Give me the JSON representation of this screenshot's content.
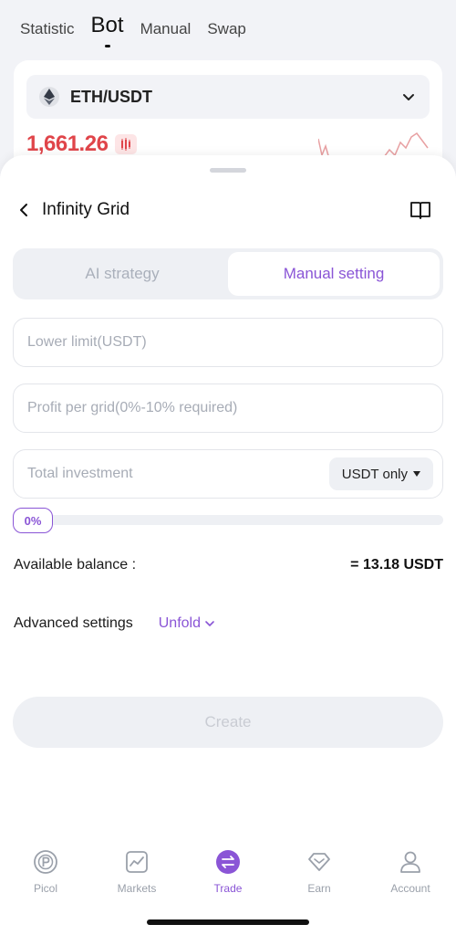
{
  "top_tabs": [
    {
      "label": "Statistic"
    },
    {
      "label": "Bot"
    },
    {
      "label": "Manual"
    },
    {
      "label": "Swap"
    }
  ],
  "pair": {
    "name": "ETH/USDT",
    "price": "1,661.26",
    "price_color": "#e0454a",
    "icon": "ethereum-icon"
  },
  "sheet": {
    "title": "Infinity Grid",
    "segments": [
      {
        "label": "AI strategy",
        "active": false
      },
      {
        "label": "Manual setting",
        "active": true
      }
    ],
    "fields": {
      "lower_limit_placeholder": "Lower limit(USDT)",
      "profit_placeholder": "Profit per grid(0%-10% required)",
      "investment_placeholder": "Total investment",
      "currency_option": "USDT only"
    },
    "slider": {
      "label": "0%",
      "value_percent": 0
    },
    "balance": {
      "label": "Available balance :",
      "value": "= 13.18 USDT"
    },
    "advanced": {
      "label": "Advanced settings",
      "toggle_label": "Unfold"
    },
    "create_label": "Create"
  },
  "bottom_nav": [
    {
      "label": "Picol",
      "icon": "picol-icon"
    },
    {
      "label": "Markets",
      "icon": "markets-icon"
    },
    {
      "label": "Trade",
      "icon": "trade-icon",
      "active": true
    },
    {
      "label": "Earn",
      "icon": "earn-icon"
    },
    {
      "label": "Account",
      "icon": "account-icon"
    }
  ],
  "colors": {
    "accent": "#8a55d6",
    "price_down": "#e0454a"
  }
}
